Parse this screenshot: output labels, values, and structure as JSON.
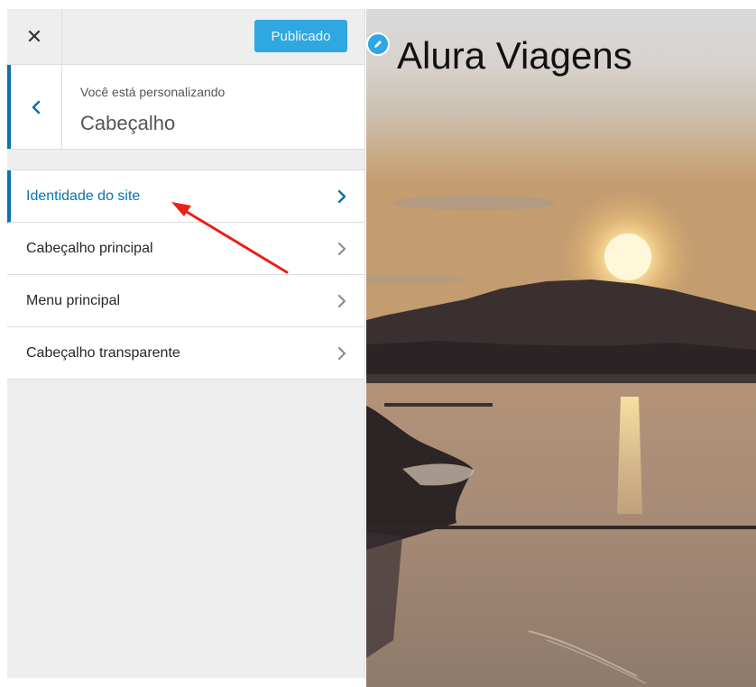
{
  "header": {
    "close_icon": "close-icon",
    "publish_label": "Publicado"
  },
  "section": {
    "back_icon": "chevron-left-icon",
    "subtitle": "Você está personalizando",
    "title": "Cabeçalho"
  },
  "menu": {
    "items": [
      {
        "label": "Identidade do site",
        "active": true
      },
      {
        "label": "Cabeçalho principal",
        "active": false
      },
      {
        "label": "Menu principal",
        "active": false
      },
      {
        "label": "Cabeçalho transparente",
        "active": false
      }
    ]
  },
  "preview": {
    "site_title": "Alura Viagens",
    "edit_icon": "pencil-icon"
  },
  "colors": {
    "accent": "#0a73aa",
    "publish_bg": "#2fa7e0",
    "annotation": "#e8201a"
  }
}
